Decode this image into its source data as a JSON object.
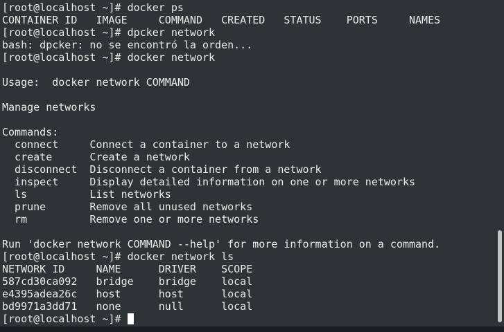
{
  "terminal": {
    "lines": [
      "[root@localhost ~]# docker ps",
      "CONTAINER ID   IMAGE     COMMAND   CREATED   STATUS    PORTS     NAMES",
      "[root@localhost ~]# dpcker network",
      "bash: dpcker: no se encontró la orden...",
      "[root@localhost ~]# docker network",
      "",
      "Usage:  docker network COMMAND",
      "",
      "Manage networks",
      "",
      "Commands:",
      "  connect     Connect a container to a network",
      "  create      Create a network",
      "  disconnect  Disconnect a container from a network",
      "  inspect     Display detailed information on one or more networks",
      "  ls          List networks",
      "  prune       Remove all unused networks",
      "  rm          Remove one or more networks",
      "",
      "Run 'docker network COMMAND --help' for more information on a command.",
      "[root@localhost ~]# docker network ls",
      "NETWORK ID     NAME      DRIVER    SCOPE",
      "587cd30ca092   bridge    bridge    local",
      "e4395adea26c   host      host      local",
      "bd9971a3dd71   none      null      local"
    ],
    "prompt": "[root@localhost ~]# "
  }
}
